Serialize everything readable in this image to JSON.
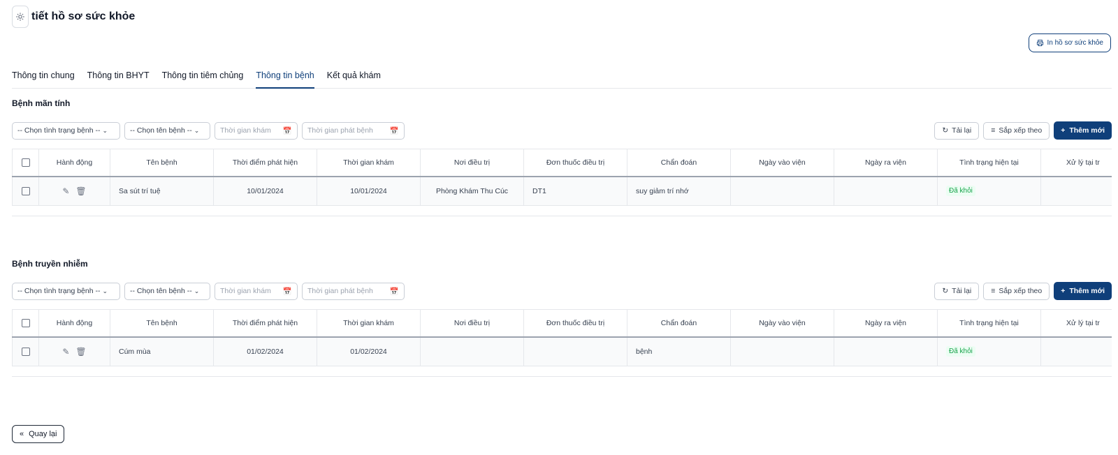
{
  "header": {
    "title": "tiết hồ sơ sức khỏe",
    "icon": "gear-icon"
  },
  "print_button": {
    "label": "In hồ sơ sức khỏe",
    "icon": "printer-icon"
  },
  "tabs": [
    {
      "label": "Thông tin chung",
      "active": false
    },
    {
      "label": "Thông tin BHYT",
      "active": false
    },
    {
      "label": "Thông tin tiêm chủng",
      "active": false
    },
    {
      "label": "Thông tin bệnh",
      "active": true
    },
    {
      "label": "Kết quả khám",
      "active": false
    }
  ],
  "columns": [
    "Hành động",
    "Tên bệnh",
    "Thời điểm phát hiện",
    "Thời gian khám",
    "Nơi điều trị",
    "Đơn thuốc điều trị",
    "Chẩn đoán",
    "Ngày vào viện",
    "Ngày ra viện",
    "Tình trạng hiện tại",
    "Xử lý tại tr"
  ],
  "filters": {
    "status_select": "-- Chọn tình trạng bệnh --",
    "name_select": "-- Chọn tên bệnh --",
    "exam_date_placeholder": "Thời gian khám",
    "onset_date_placeholder": "Thời gian phát bệnh",
    "reload_label": "Tải lại",
    "sort_label": "Sắp xếp theo",
    "add_label": "Thêm mới"
  },
  "chronic": {
    "title": "Bệnh mãn tính",
    "rows": [
      {
        "name": "Sa sút trí tuệ",
        "detected": "10/01/2024",
        "exam": "10/01/2024",
        "place": "Phòng Khám Thu Cúc",
        "prescription": "DT1",
        "diagnosis": "suy giảm trí nhớ",
        "admit": "",
        "discharge": "",
        "status": "Đã khỏi",
        "handling": ""
      }
    ]
  },
  "infectious": {
    "title": "Bệnh truyền nhiễm",
    "rows": [
      {
        "name": "Cúm mùa",
        "detected": "01/02/2024",
        "exam": "01/02/2024",
        "place": "",
        "prescription": "",
        "diagnosis": "bệnh",
        "admit": "",
        "discharge": "",
        "status": "Đã khỏi",
        "handling": ""
      }
    ]
  },
  "back_button": {
    "label": "Quay lại",
    "icon": "double-chevron-left-icon"
  },
  "colors": {
    "primary": "#0f3f7a",
    "success_text": "#16a34a",
    "success_bg": "#ecfdf3"
  }
}
